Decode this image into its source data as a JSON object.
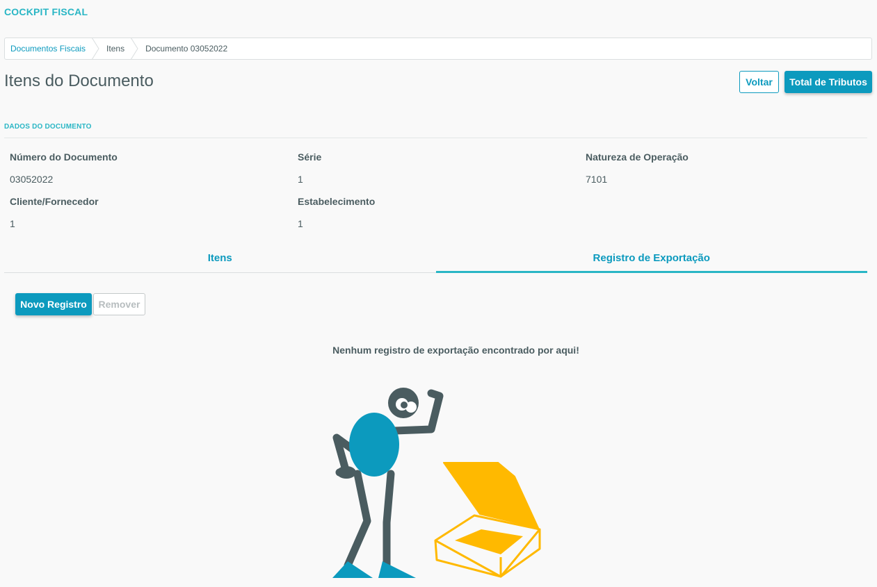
{
  "header": {
    "app_title": "COCKPIT FISCAL"
  },
  "breadcrumb": [
    {
      "label": "Documentos Fiscais",
      "link": true
    },
    {
      "label": "Itens",
      "link": false
    },
    {
      "label": "Documento 03052022",
      "link": false
    }
  ],
  "page": {
    "title": "Itens do Documento",
    "back_label": "Voltar",
    "total_label": "Total de Tributos"
  },
  "document": {
    "section_label": "DADOS DO DOCUMENTO",
    "numero_label": "Número do Documento",
    "numero_value": "03052022",
    "serie_label": "Série",
    "serie_value": "1",
    "natureza_label": "Natureza de Operação",
    "natureza_value": "7101",
    "cliente_label": "Cliente/Fornecedor",
    "cliente_value": "1",
    "estab_label": "Estabelecimento",
    "estab_value": "1"
  },
  "tabs": [
    {
      "label": "Itens",
      "active": false
    },
    {
      "label": "Registro de Exportação",
      "active": true
    }
  ],
  "actions": {
    "new_label": "Novo Registro",
    "remove_label": "Remover",
    "remove_disabled": true
  },
  "empty_state": {
    "message": "Nenhum registro de exportação encontrado por aqui!",
    "illustration_icon": "empty-box-illustration"
  },
  "colors": {
    "accent": "#0c9abe",
    "accent_light": "#29b6c5",
    "text": "#4a5c60",
    "illustration_dark": "#4a5c60",
    "illustration_blue": "#0c9abe",
    "illustration_yellow": "#ffb900"
  }
}
